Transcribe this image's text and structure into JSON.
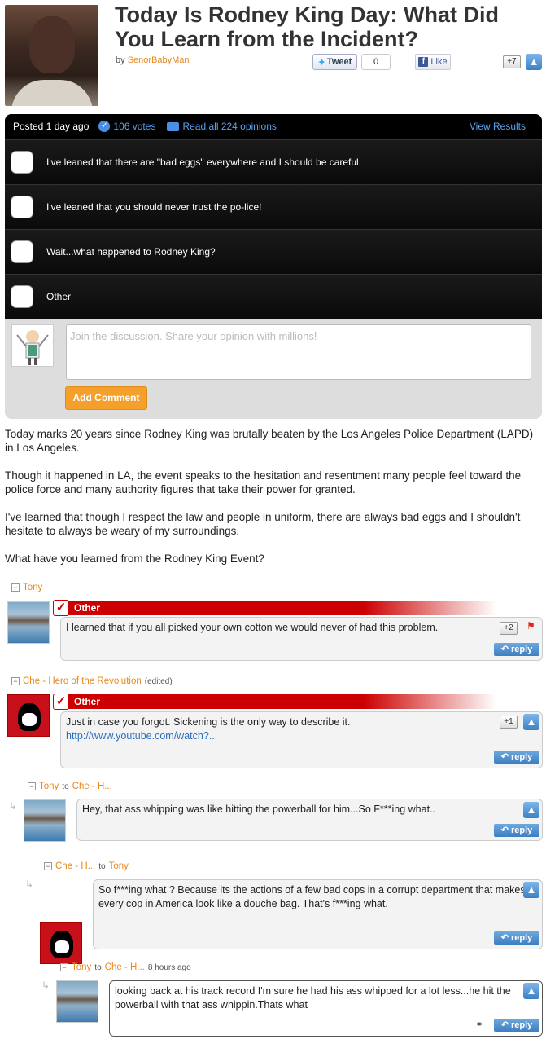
{
  "post": {
    "title": "Today Is Rodney King Day: What Did You Learn from the Incident?",
    "by_label": "by",
    "author": "SenorBabyMan",
    "tweet_label": "Tweet",
    "tweet_count": "0",
    "like_label": "Like",
    "plus_count": "+7"
  },
  "poll": {
    "posted": "Posted 1 day ago",
    "votes": "106 votes",
    "opinions": "Read all 224 opinions",
    "view_results": "View Results",
    "options": [
      "I've leaned that there are \"bad eggs\" everywhere and I should be careful.",
      "I've leaned that you should never trust the po-lice!",
      "Wait...what happened to Rodney King?",
      "Other"
    ],
    "comment_placeholder": "Join the discussion. Share your opinion with millions!",
    "add_comment": "Add Comment"
  },
  "body": {
    "p1": "Today marks 20 years since Rodney King was brutally beaten by the Los Angeles Police Department (LAPD) in Los Angeles.",
    "p2": "Though it happened in LA, the event speaks to the hesitation and resentment many people feel toward the police force and many authority figures that take their power for granted.",
    "p3": "I've learned that though I respect the law and people in uniform, there are always bad eggs and I shouldn't hesitate to always be weary of my surroundings.",
    "p4": "What have you learned from the Rodney King Event?"
  },
  "comments": [
    {
      "author": "Tony",
      "vote": "Other",
      "text": "I learned that if you all picked your own cotton we would never of had this problem.",
      "score": "+2",
      "reply": "reply"
    },
    {
      "author": "Che - Hero of the Revolution",
      "edited": "(edited)",
      "vote": "Other",
      "text": "Just in case you forgot. Sickening is the only way to describe it.",
      "link": "http://www.youtube.com/watch?...",
      "score": "+1",
      "reply": "reply"
    },
    {
      "author": "Tony",
      "to": "to",
      "target": "Che - H...",
      "text": "Hey, that ass whipping was like hitting the powerball for him...So F***ing what..",
      "reply": "reply"
    },
    {
      "author": "Che - H...",
      "to": "to",
      "target": "Tony",
      "text": "So f***ing what ? Because its the actions of a few bad cops in a corrupt department that makes every cop in America look like a douche bag. That's f***ing what.",
      "reply": "reply"
    },
    {
      "author": "Tony",
      "to": "to",
      "target": "Che - H...",
      "time": "8 hours ago",
      "text": "looking back at his track record I'm sure he had his ass whipped for a lot less...he hit the powerball with that ass whippin.Thats what",
      "reply": "reply"
    }
  ],
  "colors": {
    "accent": "#e8891e",
    "link": "#2a6ebb",
    "vote_red": "#cc0000",
    "button_orange": "#f5a02a"
  },
  "icons": [
    "twitter-bird-icon",
    "facebook-icon",
    "thumbs-up-icon",
    "check-icon",
    "speech-bubble-icon",
    "flag-icon",
    "reply-arrow-icon",
    "collapse-icon",
    "link-chain-icon"
  ]
}
